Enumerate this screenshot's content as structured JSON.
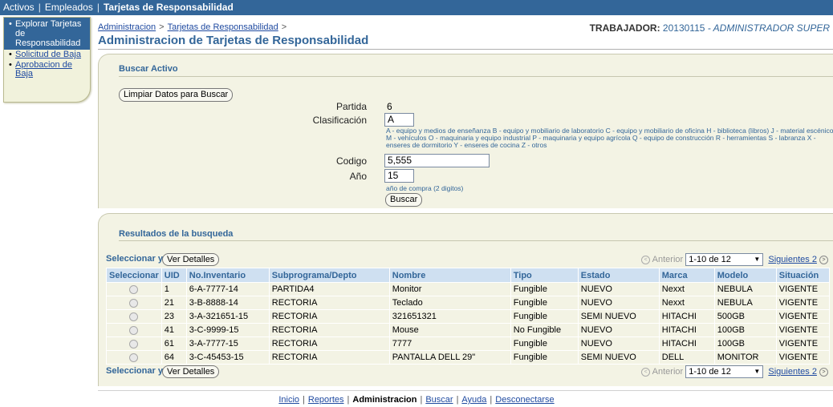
{
  "topnav": {
    "tabs": [
      "Activos",
      "Empleados"
    ],
    "current": "Tarjetas de Responsabilidad"
  },
  "sidenav": {
    "active": "Explorar Tarjetas de Responsabilidad",
    "items": [
      "Solicitud de Baja",
      "Aprobacion de Baja"
    ]
  },
  "breadcrumb": {
    "items": [
      "Administracion",
      "Tarjetas de Responsabilidad"
    ],
    "trailing": ">"
  },
  "worker": {
    "label": "TRABAJADOR:",
    "id": "20130115",
    "name": "- ADMINISTRADOR SUPER"
  },
  "page_title": "Administracion de Tarjetas de Responsabilidad",
  "search": {
    "heading": "Buscar Activo",
    "clear_button": "Limpiar Datos para Buscar",
    "partida_label": "Partida",
    "partida_value": "6",
    "clasificacion_label": "Clasificación",
    "clasificacion_value": "A",
    "clasificacion_hint": "A - equipo y medios de enseñanza B - equipo y mobiliario de laboratorio C - equipo y mobiliario de oficina H - biblioteca (libros) J - material escénico M - vehículos O - maquinaria y equipo industrial P - maquinaria y equipo agrícola Q - equipo de construcción R - herramientas S - labranza X - enseres de dormitorio Y - enseres de cocina Z - otros",
    "codigo_label": "Codigo",
    "codigo_value": "5,555",
    "anio_label": "Año",
    "anio_value": "15",
    "anio_hint": "año de compra (2 digitos)",
    "search_button": "Buscar"
  },
  "results": {
    "heading": "Resultados de la busqueda",
    "select_label": "Seleccionar y",
    "details_button": "Ver Detalles",
    "pager": {
      "prev": "Anterior",
      "range": "1-10 de 12",
      "next": "Siguientes 2"
    },
    "columns": [
      "Seleccionar",
      "UID",
      "No.Inventario",
      "Subprograma/Depto",
      "Nombre",
      "Tipo",
      "Estado",
      "Marca",
      "Modelo",
      "Situación"
    ],
    "rows": [
      [
        "1",
        "6-A-7777-14",
        "PARTIDA4",
        "Monitor",
        "Fungible",
        "NUEVO",
        "Nexxt",
        "NEBULA",
        "VIGENTE"
      ],
      [
        "21",
        "3-B-8888-14",
        "RECTORIA",
        "Teclado",
        "Fungible",
        "NUEVO",
        "Nexxt",
        "NEBULA",
        "VIGENTE"
      ],
      [
        "23",
        "3-A-321651-15",
        "RECTORIA",
        "321651321",
        "Fungible",
        "SEMI NUEVO",
        "HITACHI",
        "500GB",
        "VIGENTE"
      ],
      [
        "41",
        "3-C-9999-15",
        "RECTORIA",
        "Mouse",
        "No Fungible",
        "NUEVO",
        "HITACHI",
        "100GB",
        "VIGENTE"
      ],
      [
        "61",
        "3-A-7777-15",
        "RECTORIA",
        "7777",
        "Fungible",
        "NUEVO",
        "HITACHI",
        "100GB",
        "VIGENTE"
      ],
      [
        "64",
        "3-C-45453-15",
        "RECTORIA",
        "PANTALLA DELL 29\"",
        "Fungible",
        "SEMI NUEVO",
        "DELL",
        "MONITOR",
        "VIGENTE"
      ]
    ]
  },
  "footer": {
    "links": [
      "Inicio",
      "Reportes",
      "Administracion",
      "Buscar",
      "Ayuda",
      "Desconectarse"
    ],
    "current_index": 2
  },
  "colors": {
    "brand": "#336699",
    "panel": "#f3f3e4",
    "table_header": "#cfe0f1"
  }
}
